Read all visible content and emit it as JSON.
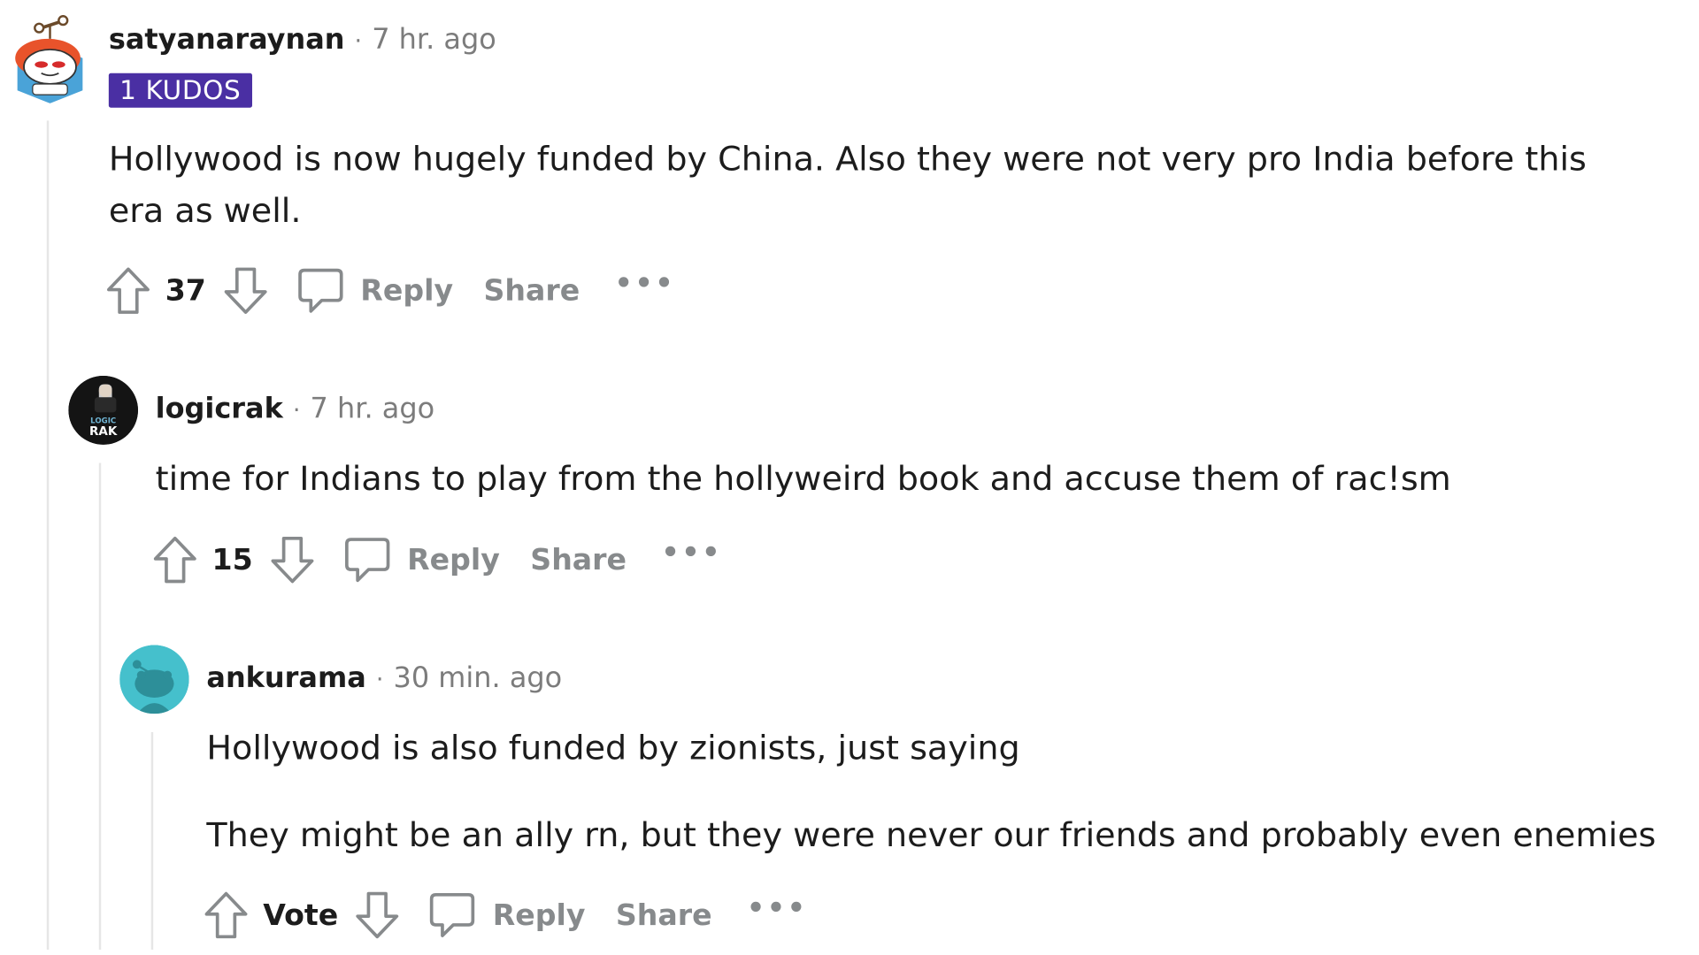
{
  "comments": [
    {
      "username": "satyanaraynan",
      "separator": "·",
      "time": "7 hr. ago",
      "flair": "1 KUDOS",
      "body": [
        "Hollywood is now hugely funded by China. Also they were not very pro India before this era as well."
      ],
      "votes": "37",
      "reply_label": "Reply",
      "share_label": "Share",
      "more_label": "•••",
      "avatar_icon": "snoo-robot-avatar-icon"
    },
    {
      "username": "logicrak",
      "separator": "·",
      "time": "7 hr. ago",
      "body": [
        "time for Indians to play from the hollyweird book and accuse them of rac!sm"
      ],
      "votes": "15",
      "reply_label": "Reply",
      "share_label": "Share",
      "more_label": "•••",
      "avatar_text": [
        "LOGIC",
        "RAK"
      ]
    },
    {
      "username": "ankurama",
      "separator": "·",
      "time": "30 min. ago",
      "body": [
        "Hollywood is also funded by zionists, just saying",
        "They might be an ally rn, but they were never our friends and probably even enemies"
      ],
      "votes": "Vote",
      "reply_label": "Reply",
      "share_label": "Share",
      "more_label": "•••",
      "avatar_icon": "default-snoo-avatar-icon"
    }
  ],
  "colors": {
    "text": "#1c1c1c",
    "muted": "#7c7c7c",
    "action": "#878a8c",
    "kudos_bg": "#4a2fa3",
    "thread_line": "#e6e6e6",
    "snoo_teal": "#45c0cc"
  }
}
